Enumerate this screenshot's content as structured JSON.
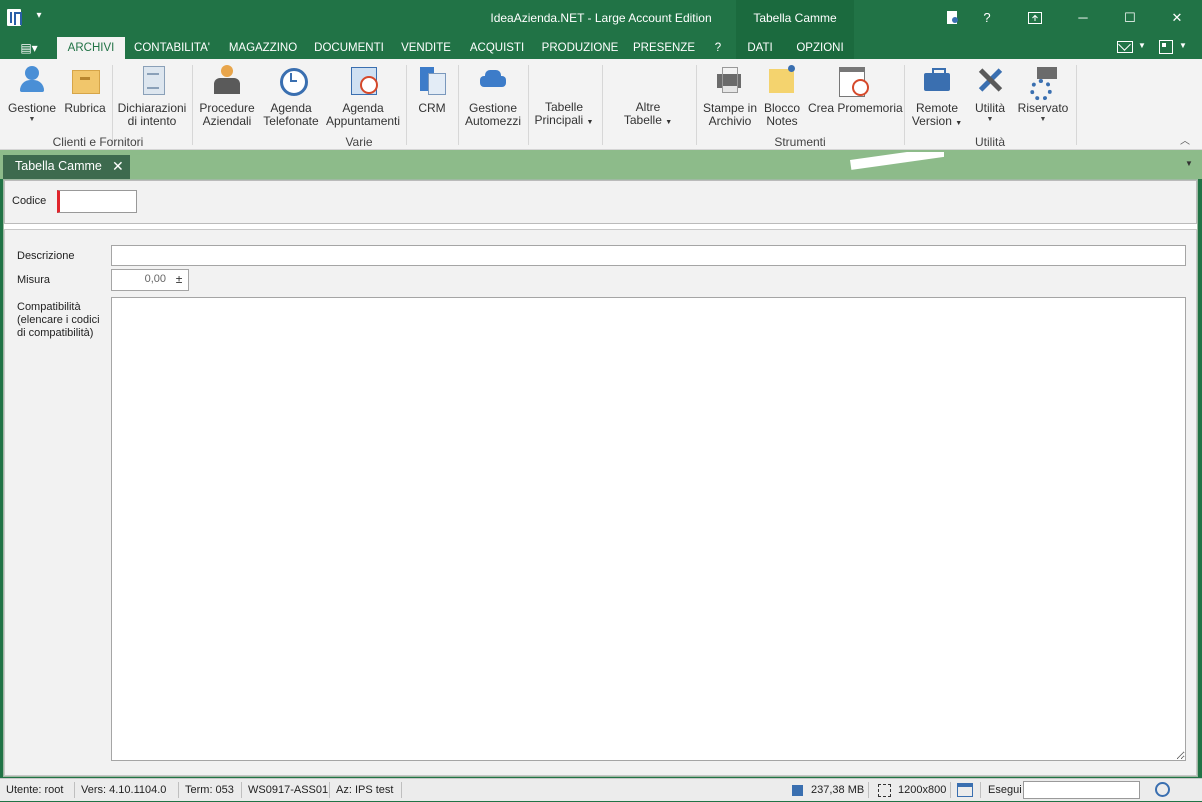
{
  "window": {
    "title": "IdeaAzienda.NET - Large Account Edition",
    "context_header": "Tabella Camme",
    "controls": {
      "help": "?",
      "minimize": "─",
      "maximize": "☐",
      "close": "✕"
    }
  },
  "tabs": {
    "file": "▤▾",
    "items": [
      "ARCHIVI",
      "CONTABILITA'",
      "MAGAZZINO",
      "DOCUMENTI",
      "VENDITE",
      "ACQUISTI",
      "PRODUZIONE",
      "PRESENZE",
      "?",
      "DATI",
      "OPZIONI"
    ],
    "active": "ARCHIVI"
  },
  "ribbon": {
    "buttons": {
      "gestione": "Gestione",
      "rubrica": "Rubrica",
      "dich1": "Dichiarazioni",
      "dich2": "di intento",
      "proc1": "Procedure",
      "proc2": "Aziendali",
      "agtel1": "Agenda",
      "agtel2": "Telefonate",
      "agapp1": "Agenda",
      "agapp2": "Appuntamenti",
      "crm": "CRM",
      "auto1": "Gestione",
      "auto2": "Automezzi",
      "tab1": "Tabelle",
      "tab2": "Principali",
      "alt1": "Altre",
      "alt2": "Tabelle",
      "stampe1": "Stampe in",
      "stampe2": "Archivio",
      "blocco1": "Blocco",
      "blocco2": "Notes",
      "promemoria": "Crea Promemoria",
      "remote1": "Remote",
      "remote2": "Version",
      "utilita": "Utilità",
      "riservato": "Riservato"
    },
    "groups": {
      "clienti": "Clienti e Fornitori",
      "varie": "Varie",
      "strumenti": "Strumenti",
      "utilita": "Utilità"
    }
  },
  "doc_tab": {
    "label": "Tabella Camme",
    "close": "✕"
  },
  "form": {
    "codice_label": "Codice",
    "codice_value": "",
    "descrizione_label": "Descrizione",
    "descrizione_value": "",
    "misura_label": "Misura",
    "misura_value": "0,00",
    "misura_spin": "±",
    "compat_label_1": "Compatibilità",
    "compat_label_2": "(elencare i codici",
    "compat_label_3": "di compatibilità)",
    "compat_value": ""
  },
  "status": {
    "utente": "Utente: root",
    "versione": "Vers: 4.10.1104.0",
    "term": "Term: 053",
    "ws": "WS0917-ASS01",
    "az": "Az: IPS test",
    "memory": "237,38 MB",
    "resolution": "1200x800",
    "esegui_label": "Esegui",
    "esegui_value": ""
  },
  "colors": {
    "accent": "#217346",
    "doc_band": "#8dbb8a",
    "required_marker": "#e0252c"
  }
}
